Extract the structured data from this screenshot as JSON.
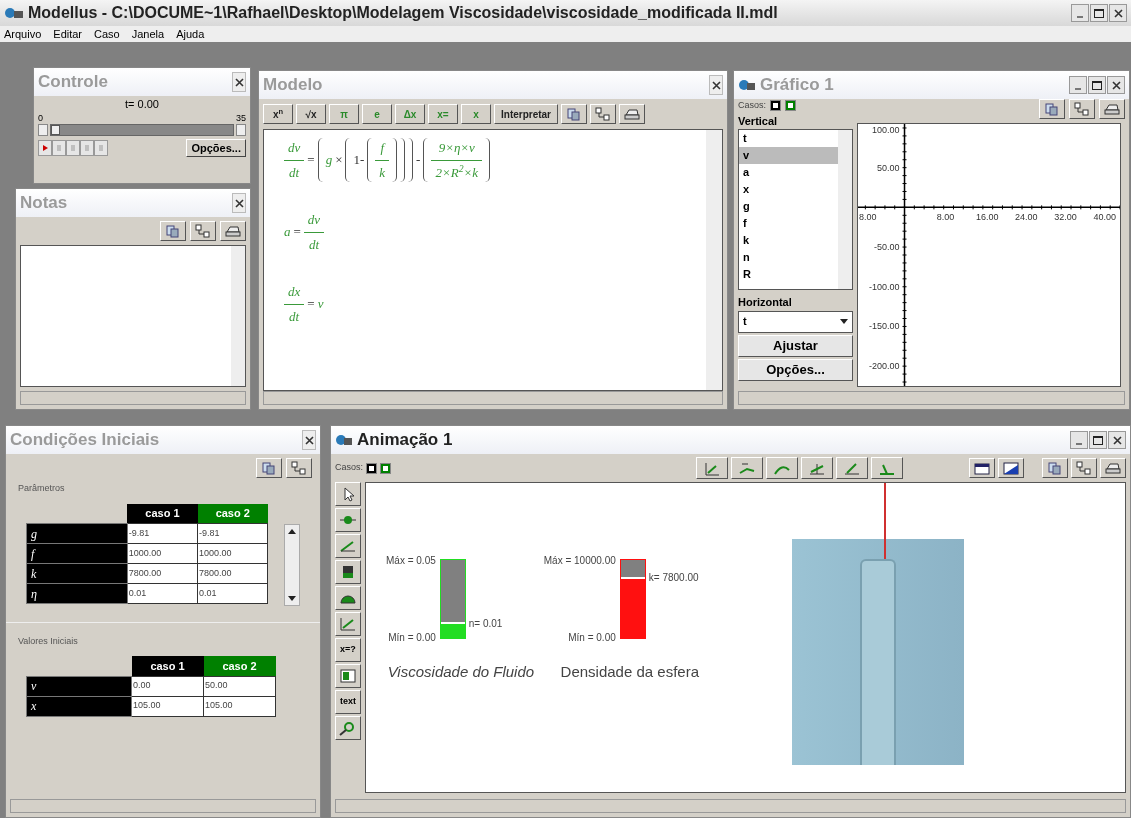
{
  "app": {
    "title": "Modellus - C:\\DOCUME~1\\Rafhael\\Desktop\\Modelagem Viscosidade\\viscosidade_modificada II.mdl",
    "menu": [
      "Arquivo",
      "Editar",
      "Caso",
      "Janela",
      "Ajuda"
    ]
  },
  "controle": {
    "title": "Controle",
    "active": false,
    "time": "t= 0.00",
    "min": "0",
    "max": "35",
    "level": 0,
    "options": "Opções..."
  },
  "notas": {
    "title": "Notas",
    "active": false
  },
  "modelo": {
    "title": "Modelo",
    "active": false,
    "toolbar": [
      "x$^{n}$",
      "√x",
      "π",
      "e",
      "Δx",
      "x=",
      "x",
      "Interpretar"
    ],
    "equations": [
      [
        {
          "kind": "frac",
          "num": "dv",
          "den": "dt"
        },
        {
          "kind": "op",
          "s": "="
        },
        {
          "kind": "open"
        },
        {
          "kind": "var",
          "s": "g"
        },
        {
          "kind": "op",
          "s": "×"
        },
        {
          "kind": "open"
        },
        {
          "kind": "op",
          "s": "1-"
        },
        {
          "kind": "open"
        },
        {
          "kind": "frac",
          "num": "f",
          "den": "k"
        },
        {
          "kind": "close"
        },
        {
          "kind": "close"
        },
        {
          "kind": "close"
        },
        {
          "kind": "op",
          "s": "-"
        },
        {
          "kind": "open"
        },
        {
          "kind": "frac",
          "num": "9×η×ν",
          "den": "2×R$^{2}$×k"
        },
        {
          "kind": "close"
        }
      ],
      [
        {
          "kind": "var",
          "s": "a"
        },
        {
          "kind": "op",
          "s": "="
        },
        {
          "kind": "frac",
          "num": "dv",
          "den": "dt"
        }
      ],
      [
        {
          "kind": "frac",
          "num": "dx",
          "den": "dt"
        },
        {
          "kind": "op",
          "s": "="
        },
        {
          "kind": "var",
          "s": "ν"
        }
      ]
    ]
  },
  "grafico": {
    "title": "Gráfico 1",
    "active": false,
    "cases_label": "Casos:",
    "cases": [
      {
        "checked": true,
        "color": "#000000"
      },
      {
        "checked": true,
        "color": "#008000"
      }
    ],
    "vertical_label": "Vertical",
    "vertical_items": [
      {
        "label": "t",
        "selected": false
      },
      {
        "label": "v",
        "selected": true
      },
      {
        "label": "a",
        "selected": false
      },
      {
        "label": "x",
        "selected": false
      },
      {
        "label": "g",
        "selected": false
      },
      {
        "label": "f",
        "selected": false
      },
      {
        "label": "k",
        "selected": false
      },
      {
        "label": "n",
        "selected": false
      },
      {
        "label": "R",
        "selected": false
      }
    ],
    "horizontal_label": "Horizontal",
    "horizontal_value": "t",
    "buttons": [
      "Ajustar",
      "Opções..."
    ],
    "chart_data": {
      "type": "line",
      "xlim": [
        -9.5,
        44
      ],
      "ylim": [
        -225,
        105
      ],
      "xticks": [
        {
          "value": -8,
          "label": "8.00"
        },
        {
          "value": 8,
          "label": "8.00"
        },
        {
          "value": 16,
          "label": "16.00"
        },
        {
          "value": 24,
          "label": "24.00"
        },
        {
          "value": 32,
          "label": "32.00"
        },
        {
          "value": 40,
          "label": "40.00"
        }
      ],
      "yticks": [
        {
          "value": 100,
          "label": "100.00"
        },
        {
          "value": 50,
          "label": "50.00"
        },
        {
          "value": -50,
          "label": "-50.00"
        },
        {
          "value": -100,
          "label": "-100.00"
        },
        {
          "value": -150,
          "label": "-150.00"
        },
        {
          "value": -200,
          "label": "-200.00"
        }
      ]
    }
  },
  "condicoes": {
    "title": "Condições Iniciais",
    "active": false,
    "sections": [
      {
        "title": "Parâmetros",
        "columns": [
          {
            "label": "caso 1",
            "color": "#000000"
          },
          {
            "label": "caso 2",
            "color": "#008000"
          }
        ],
        "rows": [
          {
            "name": "g",
            "values": [
              "-9.81",
              "-9.81"
            ]
          },
          {
            "name": "f",
            "values": [
              "1000.00",
              "1000.00"
            ]
          },
          {
            "name": "k",
            "values": [
              "7800.00",
              "7800.00"
            ]
          },
          {
            "name": "η",
            "values": [
              "0.01",
              "0.01"
            ]
          }
        ]
      },
      {
        "title": "Valores Iniciais",
        "columns": [
          {
            "label": "caso 1",
            "color": "#000000"
          },
          {
            "label": "caso 2",
            "color": "#008000"
          }
        ],
        "rows": [
          {
            "name": "ν",
            "values": [
              "0.00",
              "50.00"
            ]
          },
          {
            "name": "x",
            "values": [
              "105.00",
              "105.00"
            ]
          }
        ]
      }
    ]
  },
  "animacao": {
    "title": "Animação 1",
    "active": true,
    "cases_label": "Casos:",
    "cases": [
      {
        "checked": true,
        "color": "#000000"
      },
      {
        "checked": true,
        "color": "#008000"
      }
    ],
    "tools": [
      {
        "kind": "pointer"
      },
      {
        "kind": "particle"
      },
      {
        "kind": "vector"
      },
      {
        "kind": "level"
      },
      {
        "kind": "gauge"
      },
      {
        "kind": "plot"
      },
      {
        "kind": "label",
        "label": "x=?"
      },
      {
        "kind": "meter"
      },
      {
        "kind": "label",
        "label": "text"
      },
      {
        "kind": "tracker"
      }
    ],
    "meters": [
      {
        "color": "#22dd22",
        "level": 0.2,
        "max": "Máx = 0.05",
        "min": "Mín = 0.00",
        "reading": "n= 0.01",
        "caption": "Viscosidade do Fluido",
        "italic": true
      },
      {
        "color": "#ff1010",
        "level": 0.78,
        "max": "Máx = 10000.00",
        "min": "Mín = 0.00",
        "reading": "k= 7800.00",
        "caption": "Densidade da esfera",
        "italic": false
      }
    ]
  }
}
